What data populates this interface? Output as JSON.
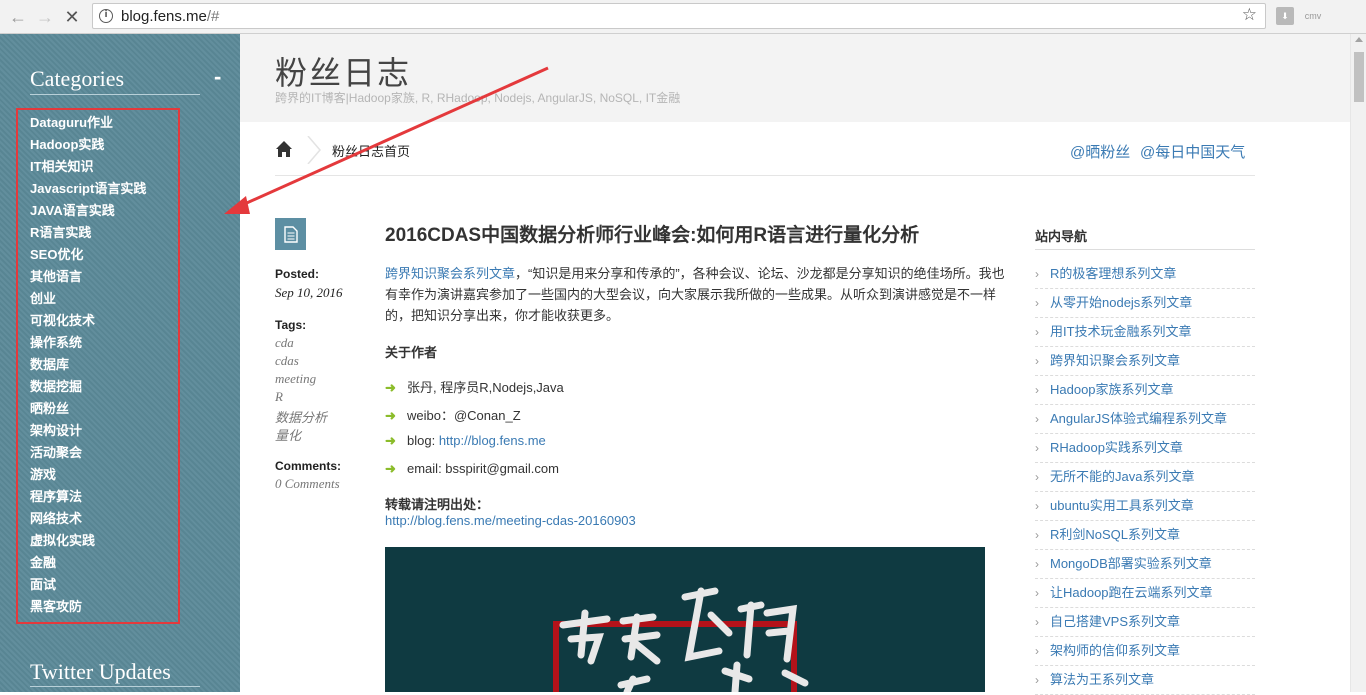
{
  "browser": {
    "url_host": "blog.fens.me",
    "url_path": "/#",
    "ext1_label": "",
    "ext2_label": "cmv"
  },
  "sidebar": {
    "categories_heading": "Categories",
    "toggle": "-",
    "categories": [
      "Dataguru作业",
      "Hadoop实践",
      "IT相关知识",
      "Javascript语言实践",
      "JAVA语言实践",
      "R语言实践",
      "SEO优化",
      "其他语言",
      "创业",
      "可视化技术",
      "操作系统",
      "数据库",
      "数据挖掘",
      "晒粉丝",
      "架构设计",
      "活动聚会",
      "游戏",
      "程序算法",
      "网络技术",
      "虚拟化实践",
      "金融",
      "面试",
      "黑客攻防"
    ],
    "twitter_heading": "Twitter Updates"
  },
  "header": {
    "title": "粉丝日志",
    "subtitle": "跨界的IT博客|Hadoop家族, R, RHadoop, Nodejs, AngularJS, NoSQL, IT金融"
  },
  "nav": {
    "home": "粉丝日志首页",
    "link1": "@晒粉丝",
    "link2": "@每日中国天气"
  },
  "meta": {
    "posted_label": "Posted:",
    "date": "Sep 10, 2016",
    "tags_label": "Tags:",
    "tags": [
      "cda",
      "cdas",
      "meeting",
      "R",
      "数据分析",
      "量化"
    ],
    "comments_label": "Comments:",
    "comments": "0 Comments"
  },
  "post": {
    "title": "2016CDAS中国数据分析师行业峰会:如何用R语言进行量化分析",
    "intro_link": "跨界知识聚会系列文章",
    "intro": "，“知识是用来分享和传承的”，各种会议、论坛、沙龙都是分享知识的绝佳场所。我也有幸作为演讲嘉宾参加了一些国内的大型会议，向大家展示我所做的一些成果。从听众到演讲感觉是不一样的，把知识分享出来，你才能收获更多。",
    "about_heading": "关于作者",
    "author_1": "张丹, 程序员R,Nodejs,Java",
    "author_2": "weibo：@Conan_Z",
    "author_3_label": "blog: ",
    "author_3_link": "http://blog.fens.me",
    "author_4": "email: bsspirit@gmail.com",
    "repost_heading": "转载请注明出处：",
    "repost_link": "http://blog.fens.me/meeting-cdas-20160903"
  },
  "widget": {
    "title": "站内导航",
    "items": [
      "R的极客理想系列文章",
      "从零开始nodejs系列文章",
      "用IT技术玩金融系列文章",
      "跨界知识聚会系列文章",
      "Hadoop家族系列文章",
      "AngularJS体验式编程系列文章",
      "RHadoop实践系列文章",
      "无所不能的Java系列文章",
      "ubuntu实用工具系列文章",
      "R利剑NoSQL系列文章",
      "MongoDB部署实验系列文章",
      "让Hadoop跑在云端系列文章",
      "自己搭建VPS系列文章",
      "架构师的信仰系列文章",
      "算法为王系列文章"
    ]
  },
  "colors": {
    "sidebar": "#5c8a99",
    "link": "#3a7ab3",
    "annotation_red": "#e4393c",
    "bullet_green": "#8bbc2a"
  }
}
